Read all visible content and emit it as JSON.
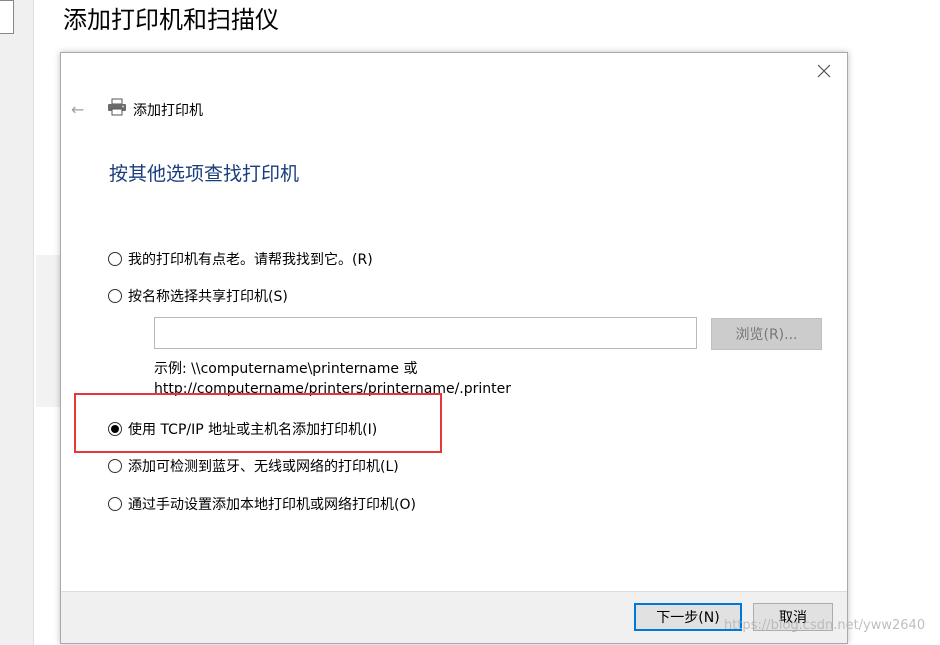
{
  "background": {
    "window_title": "添加打印机和扫描仪"
  },
  "dialog": {
    "close_icon": "close-icon",
    "back_icon": "back-arrow-icon",
    "printer_icon": "printer-icon",
    "wizard_title": "添加打印机",
    "heading": "按其他选项查找打印机",
    "options": [
      {
        "label": "我的打印机有点老。请帮我找到它。(R)",
        "checked": false
      },
      {
        "label": "按名称选择共享打印机(S)",
        "checked": false
      },
      {
        "label": "使用 TCP/IP 地址或主机名添加打印机(I)",
        "checked": true
      },
      {
        "label": "添加可检测到蓝牙、无线或网络的打印机(L)",
        "checked": false
      },
      {
        "label": "通过手动设置添加本地打印机或网络打印机(O)",
        "checked": false
      }
    ],
    "share_input_value": "",
    "browse_label": "浏览(R)...",
    "example_line1": "示例: \\\\computername\\printername 或",
    "example_line2": "http://computername/printers/printername/.printer",
    "highlight_color": "#e53935",
    "next_label": "下一步(N)",
    "cancel_label": "取消"
  },
  "watermark": "https://blog.csdn.net/yww2640"
}
